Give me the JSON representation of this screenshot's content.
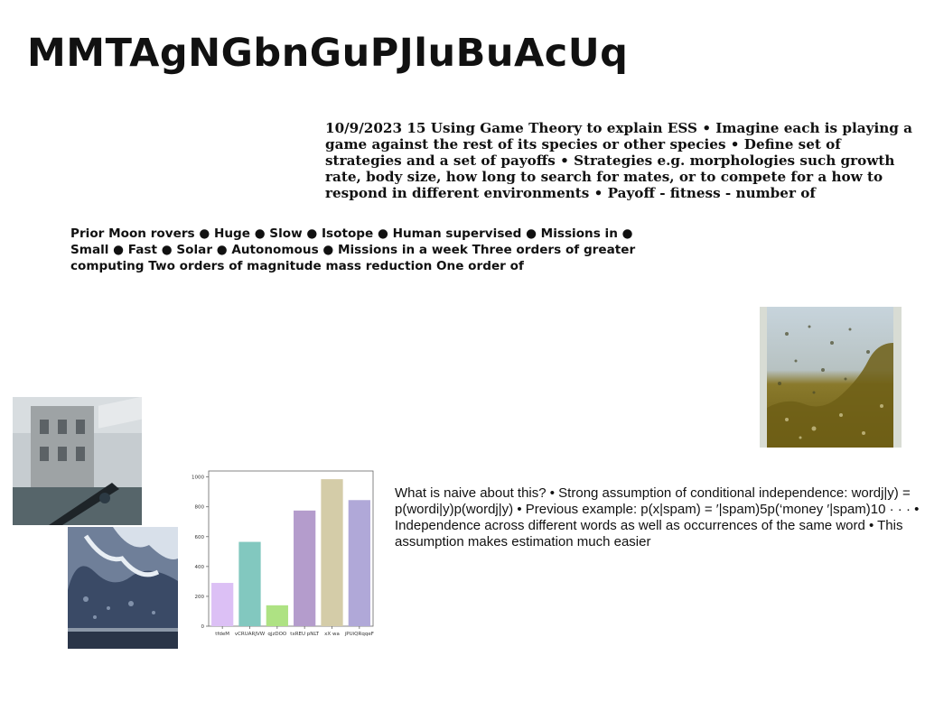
{
  "title": "MMTAgNGbnGuPJluBuAcUq",
  "text_blocks": {
    "game_theory": "10/9/2023 15 Using Game Theory to explain ESS • Imagine each is playing a game against the rest of its species or other species • Define set of strategies and a set of payoffs • Strategies e.g. morphologies such growth rate, body size, how long to search for mates, or to compete for a how to respond in different environments • Payoff - fitness - number of",
    "moon_rovers": "Prior Moon rovers ● Huge ● Slow ● Isotope ● Human supervised ● Missions in ● Small ● Fast ● Solar ● Autonomous ● Missions in a week Three orders of greater computing Two orders of magnitude mass reduction One order of",
    "naive_bayes": "What is naive about this? • Strong assumption of conditional independence: wordj|y) = p(wordi|y)p(wordj|y) • Previous example: p(x|spam) = ′|spam)5p(‘money ′|spam)10 · · · • Independence across different words as well as occurrences of the same word • This assumption makes estimation much easier"
  },
  "chart_data": {
    "type": "bar",
    "categories": [
      "tfdeM",
      "vCRUARJVW",
      "qjzDOO",
      "txREU pNLT",
      "xX wa",
      "jPUiQRqqeF"
    ],
    "values": [
      290,
      565,
      140,
      775,
      985,
      845
    ],
    "colors": [
      "#dcc0f5",
      "#82c8bf",
      "#aee283",
      "#b49ccc",
      "#d4cca8",
      "#b0a8d8"
    ],
    "ylim": [
      0,
      1040
    ],
    "yticks": [
      0,
      200,
      400,
      600,
      800,
      1000
    ],
    "xlabel": "",
    "ylabel": "",
    "title": ""
  },
  "images": {
    "building": "photo of building with telescope",
    "waterfall": "photo of frozen waterfall",
    "liquid": "photo of liquid with bubbles"
  }
}
